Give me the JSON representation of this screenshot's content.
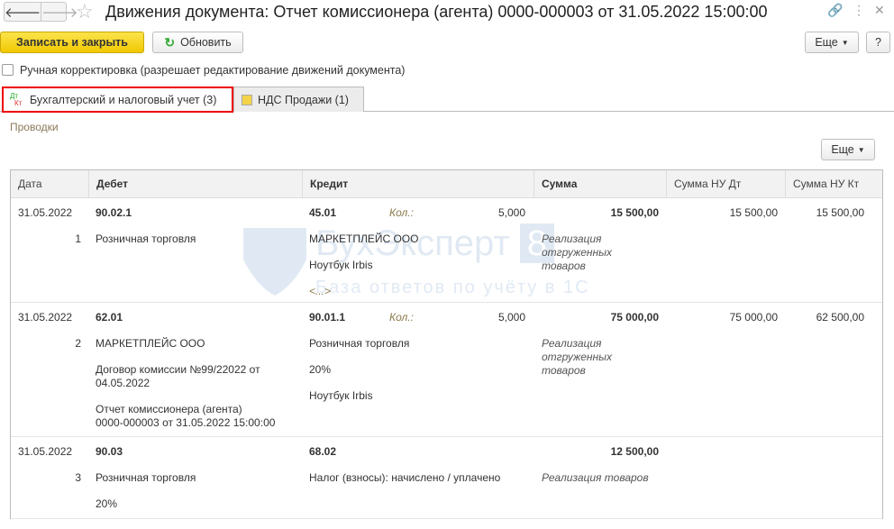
{
  "window": {
    "title": "Движения документа: Отчет комиссионера (агента) 0000-000003 от 31.05.2022 15:00:00",
    "link_icon": "link-icon",
    "more_icon": "kebab-icon",
    "close_icon": "close-icon"
  },
  "toolbar": {
    "save_close": "Записать и закрыть",
    "refresh": "Обновить",
    "more": "Еще",
    "help": "?"
  },
  "manual": {
    "label": "Ручная корректировка (разрешает редактирование движений документа)",
    "checked": false
  },
  "tabs": [
    {
      "label": "Бухгалтерский и налоговый учет (3)",
      "icon": "dt-kt-icon",
      "active": true
    },
    {
      "label": "НДС Продажи (1)",
      "icon": "register-icon",
      "active": false
    }
  ],
  "section": {
    "title": "Проводки",
    "more": "Еще"
  },
  "table": {
    "columns": [
      "Дата",
      "Дебет",
      "Кредит",
      "Сумма",
      "Сумма НУ Дт",
      "Сумма НУ Кт"
    ],
    "rows": [
      {
        "date": "31.05.2022",
        "num": "1",
        "debit": "90.02.1",
        "debit_lines": [
          "Розничная торговля"
        ],
        "credit": "45.01",
        "qty_label": "Кол.:",
        "qty": "5,000",
        "credit_lines": [
          "МАРКЕТПЛЕЙС ООО",
          "Ноутбук Irbis",
          "<...>"
        ],
        "sum": "15 500,00",
        "content": [
          "Реализация",
          "отгруженных",
          "товаров"
        ],
        "nu_dt": "15 500,00",
        "nu_kt": "15 500,00"
      },
      {
        "date": "31.05.2022",
        "num": "2",
        "debit": "62.01",
        "debit_lines": [
          "МАРКЕТПЛЕЙС ООО",
          "Договор комиссии №99/22022 от",
          "04.05.2022",
          "Отчет комиссионера (агента)",
          "0000-000003 от 31.05.2022 15:00:00"
        ],
        "credit": "90.01.1",
        "qty_label": "Кол.:",
        "qty": "5,000",
        "credit_lines": [
          "Розничная торговля",
          "20%",
          "Ноутбук Irbis"
        ],
        "sum": "75 000,00",
        "content": [
          "Реализация",
          "отгруженных",
          "товаров"
        ],
        "nu_dt": "75 000,00",
        "nu_kt": "62 500,00"
      },
      {
        "date": "31.05.2022",
        "num": "3",
        "debit": "90.03",
        "debit_lines": [
          "Розничная торговля",
          "20%"
        ],
        "credit": "68.02",
        "credit_lines": [
          "Налог (взносы): начислено / уплачено"
        ],
        "sum": "12 500,00",
        "content": [
          "Реализация товаров"
        ]
      }
    ]
  },
  "watermark": {
    "brand": "БухЭксперт",
    "digit": "8",
    "tagline": "База ответов по учёту в 1С"
  }
}
